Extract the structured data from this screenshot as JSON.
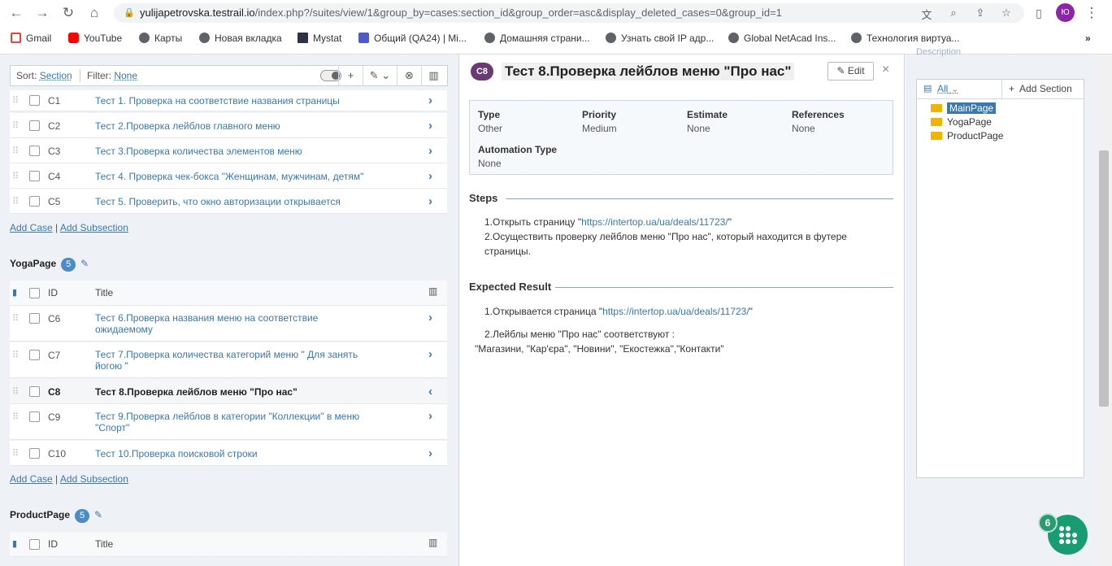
{
  "browser": {
    "url_host": "yulijapetrovska.testrail.io",
    "url_rest": "/index.php?/suites/view/1&group_by=cases:section_id&group_order=asc&display_deleted_cases=0&group_id=1",
    "profile_initials": "Ю"
  },
  "bookmarks": [
    {
      "label": "Gmail",
      "icon": "gmail-icon"
    },
    {
      "label": "YouTube",
      "icon": "youtube-icon"
    },
    {
      "label": "Карты",
      "icon": "globe-icon"
    },
    {
      "label": "Новая вкладка",
      "icon": "globe-icon"
    },
    {
      "label": "Mystat",
      "icon": "graduation-cap-icon"
    },
    {
      "label": "Общий (QA24) | Mi...",
      "icon": "teams-icon"
    },
    {
      "label": "Домашняя страни...",
      "icon": "globe-icon"
    },
    {
      "label": "Узнать свой IP адр...",
      "icon": "globe-icon"
    },
    {
      "label": "Global NetAcad Ins...",
      "icon": "globe-icon"
    },
    {
      "label": "Технология виртуа...",
      "icon": "globe-icon"
    }
  ],
  "toolbar": {
    "sort_label": "Sort:",
    "sort_value": "Section",
    "filter_label": "Filter:",
    "filter_value": "None"
  },
  "table_header": {
    "id": "ID",
    "title": "Title"
  },
  "sections": [
    {
      "name": "MainPage",
      "cases": [
        {
          "id": "C1",
          "title": "Тест 1. Проверка на соответствие названия страницы"
        },
        {
          "id": "C2",
          "title": "Тест 2.Проверка лейблов главного меню"
        },
        {
          "id": "C3",
          "title": "Тест 3.Проверка количества элементов меню"
        },
        {
          "id": "C4",
          "title": "Тест 4. Проверка чек-бокса \"Женщинам, мужчинам, детям\""
        },
        {
          "id": "C5",
          "title": "Тест 5. Проверить, что окно авторизации открывается"
        }
      ]
    },
    {
      "name": "YogaPage",
      "count": "5",
      "cases": [
        {
          "id": "C6",
          "title": "Тест 6.Проверка названия меню на соответствие ожидаемому"
        },
        {
          "id": "C7",
          "title": "Тест 7.Проверка количества категорий меню \" Для занять йогою \""
        },
        {
          "id": "C8",
          "title": "Тест 8.Проверка лейблов меню \"Про нас\""
        },
        {
          "id": "C9",
          "title": "Тест 9.Проверка лейблов в категории \"Коллекции\" в меню \"Спорт\""
        },
        {
          "id": "C10",
          "title": "Тест 10.Проверка поисковой строки"
        }
      ]
    },
    {
      "name": "ProductPage",
      "count": "5"
    }
  ],
  "links": {
    "add_case": "Add Case",
    "add_subsection": "Add Subsection"
  },
  "case_detail": {
    "id": "C8",
    "title": "Тест 8.Проверка лейблов меню \"Про нас\"",
    "edit_label": "Edit",
    "fields": [
      {
        "label": "Type",
        "value": "Other"
      },
      {
        "label": "Priority",
        "value": "Medium"
      },
      {
        "label": "Estimate",
        "value": "None"
      },
      {
        "label": "References",
        "value": "None"
      },
      {
        "label": "Automation Type",
        "value": "None"
      }
    ],
    "steps_header": "Steps",
    "steps_line1_pre": "1.Открыть страницу \"",
    "steps_link": "https://intertop.ua/ua/deals/11723/",
    "steps_line1_post": "\"",
    "steps_line2": "2.Осуществить проверку лейблов меню \"Про нас\", который находится в футере страницы.",
    "expected_header": "Expected Result",
    "expected_line1_pre": "1.Открывается страница \"",
    "expected_link": "https://intertop.ua/ua/deals/11723/",
    "expected_line1_post": "\"",
    "expected_line2": "2.Лейблы меню \"Про нас\" соответствуют :",
    "expected_line3": "\"Магазини, \"Кар'єра\", \"Новини\", \"Екостежка\",\"Контакти\""
  },
  "tree": {
    "filter_label": "All",
    "add_section_label": "Add Section",
    "nodes": [
      "MainPage",
      "YogaPage",
      "ProductPage"
    ],
    "selected": "MainPage",
    "faded_label": "Description"
  },
  "help_badge": "6"
}
